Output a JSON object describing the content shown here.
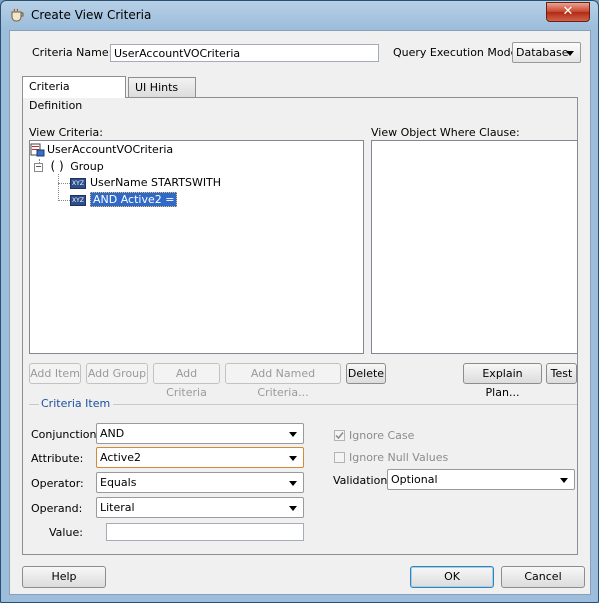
{
  "window": {
    "title": "Create View Criteria",
    "close_symbol": "✕"
  },
  "criteria_name": {
    "label": "Criteria Name:",
    "value": "UserAccountVOCriteria"
  },
  "query_mode": {
    "label": "Query Execution Mode:",
    "value": "Database"
  },
  "tabs": [
    {
      "label": "Criteria Definition",
      "active": true
    },
    {
      "label": "UI Hints",
      "active": false
    }
  ],
  "view_criteria": {
    "label": "View Criteria:",
    "root": "UserAccountVOCriteria",
    "group_symbol": "( )",
    "group_label": "Group",
    "items": [
      {
        "label": "UserName STARTSWITH",
        "badge": "XYZ"
      },
      {
        "label": "AND Active2 =",
        "badge": "XYZ",
        "selected": true
      }
    ]
  },
  "where_clause": {
    "label": "View Object Where Clause:"
  },
  "buttons": {
    "add_item": "Add Item",
    "add_group": "Add Group",
    "add_criteria": "Add Criteria",
    "add_named_criteria": "Add Named Criteria...",
    "delete": "Delete",
    "explain_plan": "Explain Plan...",
    "test": "Test",
    "help": "Help",
    "ok": "OK",
    "cancel": "Cancel"
  },
  "criteria_item": {
    "section_label": "Criteria Item",
    "conjunction": {
      "label": "Conjunction:",
      "value": "AND"
    },
    "attribute": {
      "label": "Attribute:",
      "value": "Active2"
    },
    "operator": {
      "label": "Operator:",
      "value": "Equals"
    },
    "operand": {
      "label": "Operand:",
      "value": "Literal"
    },
    "value": {
      "label": "Value:",
      "value": ""
    },
    "ignore_case": {
      "label": "Ignore Case",
      "checked": true
    },
    "ignore_null": {
      "label": "Ignore Null Values",
      "checked": false
    },
    "validation": {
      "label": "Validation:",
      "value": "Optional"
    }
  }
}
